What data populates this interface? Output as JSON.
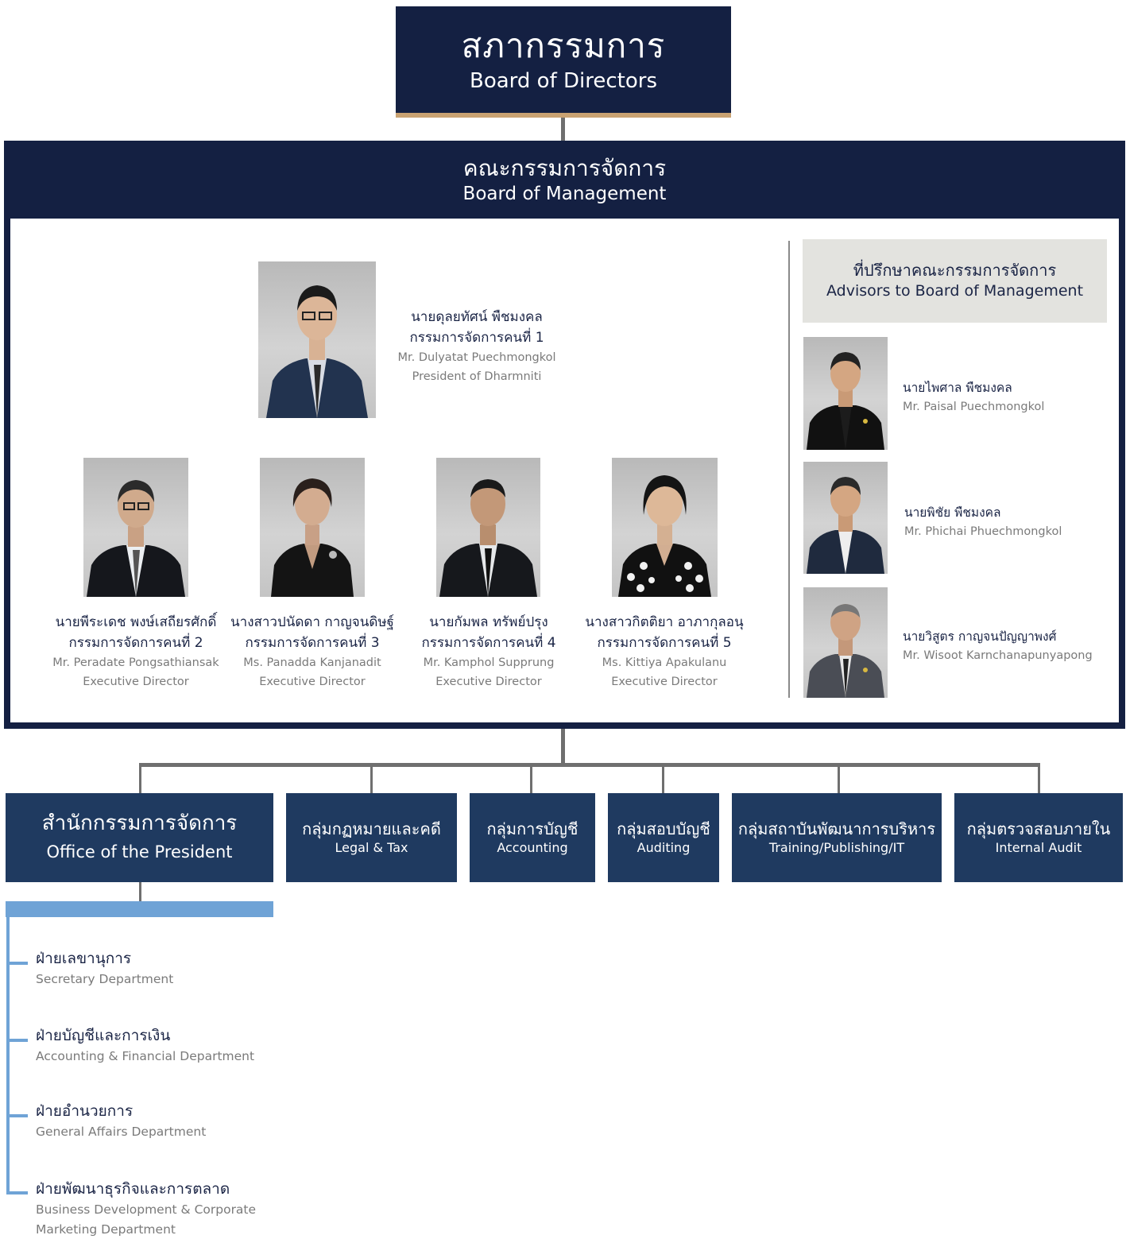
{
  "board_of_directors": {
    "th": "สภากรรมการ",
    "en": "Board of Directors"
  },
  "board_of_management": {
    "th": "คณะกรรมการจัดการ",
    "en": "Board of Management"
  },
  "president": {
    "th_name": "นายดุลยทัศน์ พืชมงคล",
    "th_title": "กรรมการจัดการคนที่ 1",
    "en_name": "Mr. Dulyatat Puechmongkol",
    "en_title": "President of Dharmniti"
  },
  "directors": [
    {
      "th_name": "นายพีระเดช พงษ์เสถียรศักดิ์",
      "th_title": "กรรมการจัดการคนที่ 2",
      "en_name": "Mr. Peradate Pongsathiansak",
      "en_title": "Executive Director"
    },
    {
      "th_name": "นางสาวปนัดดา กาญจนดิษฐ์",
      "th_title": "กรรมการจัดการคนที่ 3",
      "en_name": "Ms. Panadda Kanjanadit",
      "en_title": "Executive Director"
    },
    {
      "th_name": "นายกัมพล ทรัพย์ปรุง",
      "th_title": "กรรมการจัดการคนที่ 4",
      "en_name": "Mr. Kamphol Supprung",
      "en_title": "Executive Director"
    },
    {
      "th_name": "นางสาวกิตติยา อาภากุลอนุ",
      "th_title": "กรรมการจัดการคนที่ 5",
      "en_name": "Ms. Kittiya Apakulanu",
      "en_title": "Executive Director"
    }
  ],
  "advisors": {
    "heading_th": "ที่ปรึกษาคณะกรรมการจัดการ",
    "heading_en": "Advisors to Board of Management",
    "people": [
      {
        "th_name": "นายไพศาล พืชมงคล",
        "en_name": "Mr. Paisal Puechmongkol"
      },
      {
        "th_name": "นายพิชัย พืชมงคล",
        "en_name": "Mr. Phichai Phuechmongkol"
      },
      {
        "th_name": "นายวิสูตร กาญจนปัญญาพงศ์",
        "en_name": "Mr. Wisoot Karnchanapunyapong"
      }
    ]
  },
  "departments": [
    {
      "th": "สำนักกรรมการจัดการ",
      "en": "Office of the President"
    },
    {
      "th": "กลุ่มกฏหมายและคดี",
      "en": "Legal & Tax"
    },
    {
      "th": "กลุ่มการบัญชี",
      "en": "Accounting"
    },
    {
      "th": "กลุ่มสอบบัญชี",
      "en": "Auditing"
    },
    {
      "th": "กลุ่มสถาบันพัฒนาการบริหาร",
      "en": "Training/Publishing/IT"
    },
    {
      "th": "กลุ่มตรวจสอบภายใน",
      "en": "Internal Audit"
    }
  ],
  "office_divisions": [
    {
      "th": "ฝ่ายเลขานุการ",
      "en": "Secretary Department"
    },
    {
      "th": "ฝ่ายบัญชีและการเงิน",
      "en": "Accounting & Financial Department"
    },
    {
      "th": "ฝ่ายอำนวยการ",
      "en": "General Affairs Department"
    },
    {
      "th": "ฝ่ายพัฒนาธุรกิจและการตลาด",
      "en": "Business Development & Corporate",
      "en2": "Marketing Department"
    }
  ],
  "colors": {
    "navy": "#142042",
    "dept_blue": "#1f3a60",
    "gold": "#c9a272",
    "light_blue": "#6fa3d6",
    "advisor_bg": "#e3e3df"
  }
}
